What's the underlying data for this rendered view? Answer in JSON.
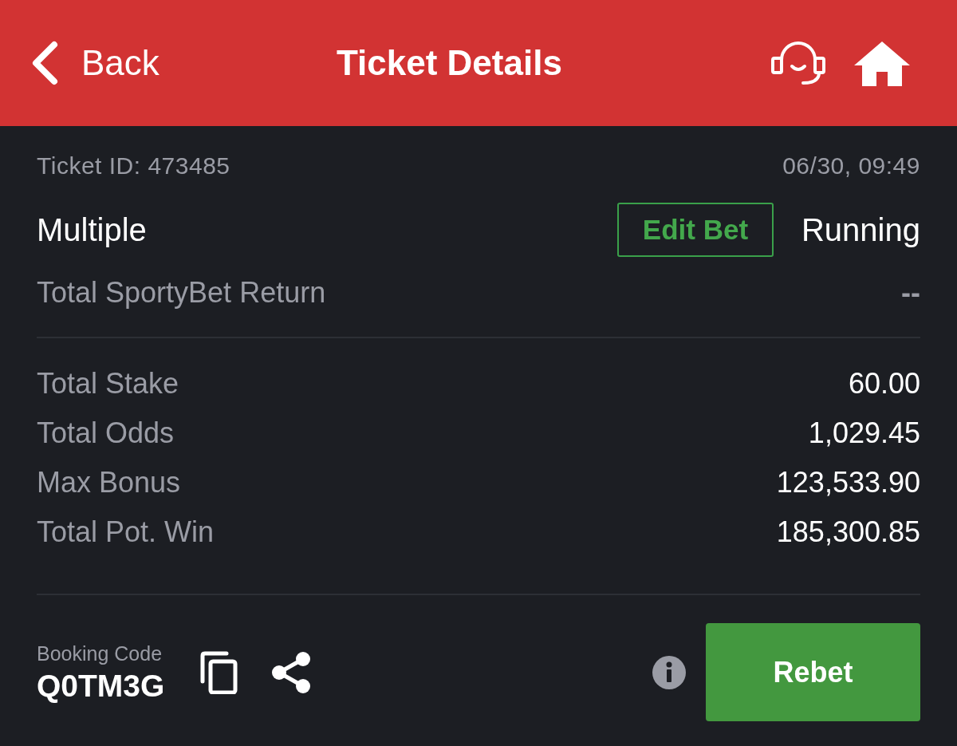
{
  "header": {
    "back_label": "Back",
    "title": "Ticket Details"
  },
  "ticket": {
    "id_label": "Ticket ID: 473485",
    "datetime": "06/30, 09:49",
    "type": "Multiple",
    "edit_button": "Edit Bet",
    "status": "Running",
    "return_label": "Total SportyBet Return",
    "return_value": "--"
  },
  "summary": [
    {
      "label": "Total Stake",
      "value": "60.00"
    },
    {
      "label": "Total Odds",
      "value": "1,029.45"
    },
    {
      "label": "Max Bonus",
      "value": "123,533.90"
    },
    {
      "label": "Total Pot. Win",
      "value": "185,300.85"
    }
  ],
  "booking": {
    "label": "Booking Code",
    "code": "Q0TM3G"
  },
  "rebet_button": "Rebet"
}
